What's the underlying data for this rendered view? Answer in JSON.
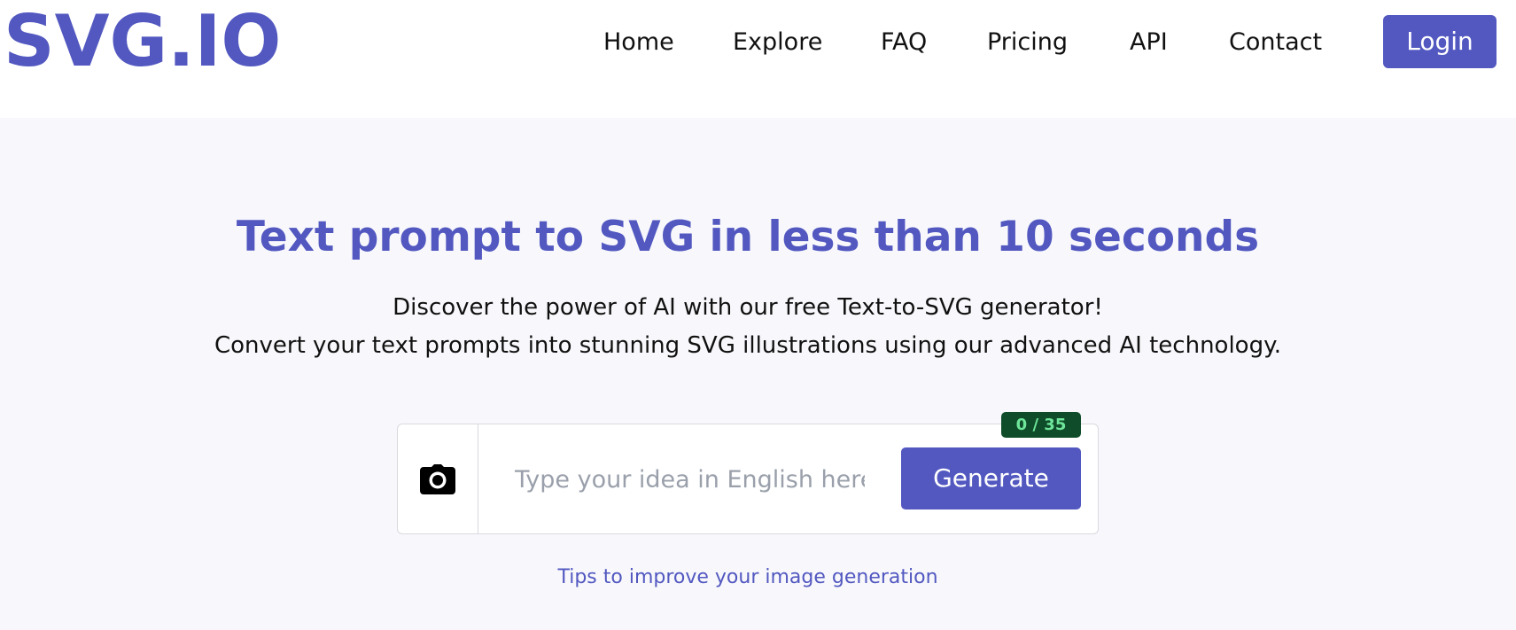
{
  "brand": {
    "logo_text": "SVG.IO",
    "accent_color": "#5258c0"
  },
  "nav": {
    "items": [
      {
        "label": "Home"
      },
      {
        "label": "Explore"
      },
      {
        "label": "FAQ"
      },
      {
        "label": "Pricing"
      },
      {
        "label": "API"
      },
      {
        "label": "Contact"
      }
    ],
    "login_label": "Login"
  },
  "hero": {
    "headline": "Text prompt to SVG in less than 10 seconds",
    "subtitle_line1": "Discover the power of AI with our free Text-to-SVG generator!",
    "subtitle_line2": "Convert your text prompts into stunning SVG illustrations using our advanced AI technology."
  },
  "prompt": {
    "placeholder": "Type your idea in English here",
    "value": "",
    "counter": "0 / 35",
    "generate_label": "Generate",
    "upload_icon": "camera-icon"
  },
  "tips": {
    "label": "Tips to improve your image generation"
  }
}
